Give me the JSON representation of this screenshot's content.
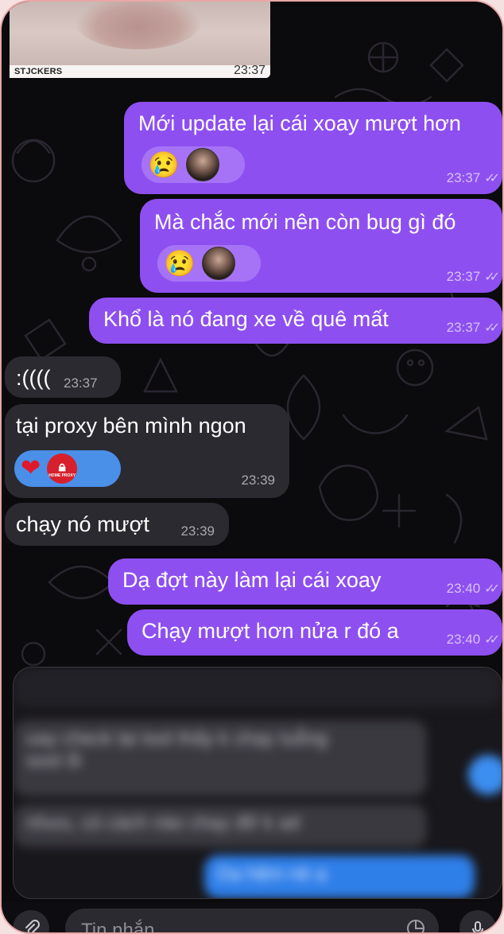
{
  "top_media": {
    "tag": "STJCKERS",
    "time": "23:37"
  },
  "messages": [
    {
      "dir": "out",
      "text": "Mới update lại cái xoay mượt hơn",
      "time": "23:37",
      "reaction": {
        "emoji": "😢",
        "avatar": "user-avatar"
      }
    },
    {
      "dir": "out",
      "text": "Mà chắc mới nên còn bug gì đó",
      "time": "23:37",
      "reaction": {
        "emoji": "😢",
        "avatar": "user-avatar"
      }
    },
    {
      "dir": "out",
      "text": "Khổ là nó đang xe về quê mất",
      "time": "23:37"
    },
    {
      "dir": "in",
      "text": ":((((",
      "time": "23:37"
    },
    {
      "dir": "in",
      "text": "tại proxy bên mình ngon",
      "time": "23:39",
      "reaction": {
        "emoji": "❤",
        "badge_text": "HOME PROXY"
      }
    },
    {
      "dir": "in",
      "text": "chạy nó mượt",
      "time": "23:39"
    },
    {
      "dir": "out",
      "text": "Dạ đợt này làm lại cái xoay",
      "time": "23:40"
    },
    {
      "dir": "out",
      "text": "Chạy mượt hơn nửa r đó a",
      "time": "23:40"
    }
  ],
  "blurred_panel": {
    "rows": [
      "uay check lại tool thấy k chạy tuỗng",
      "sool ổi",
      "nhưu, có cách nào chạy đỡ k ad",
      "Dạ hệm nè ạ"
    ]
  },
  "composer": {
    "placeholder": "Tin nhắn"
  },
  "colors": {
    "outgoing": "#8e4ff0",
    "incoming": "#2b2a30",
    "background": "#0b0a0c"
  }
}
